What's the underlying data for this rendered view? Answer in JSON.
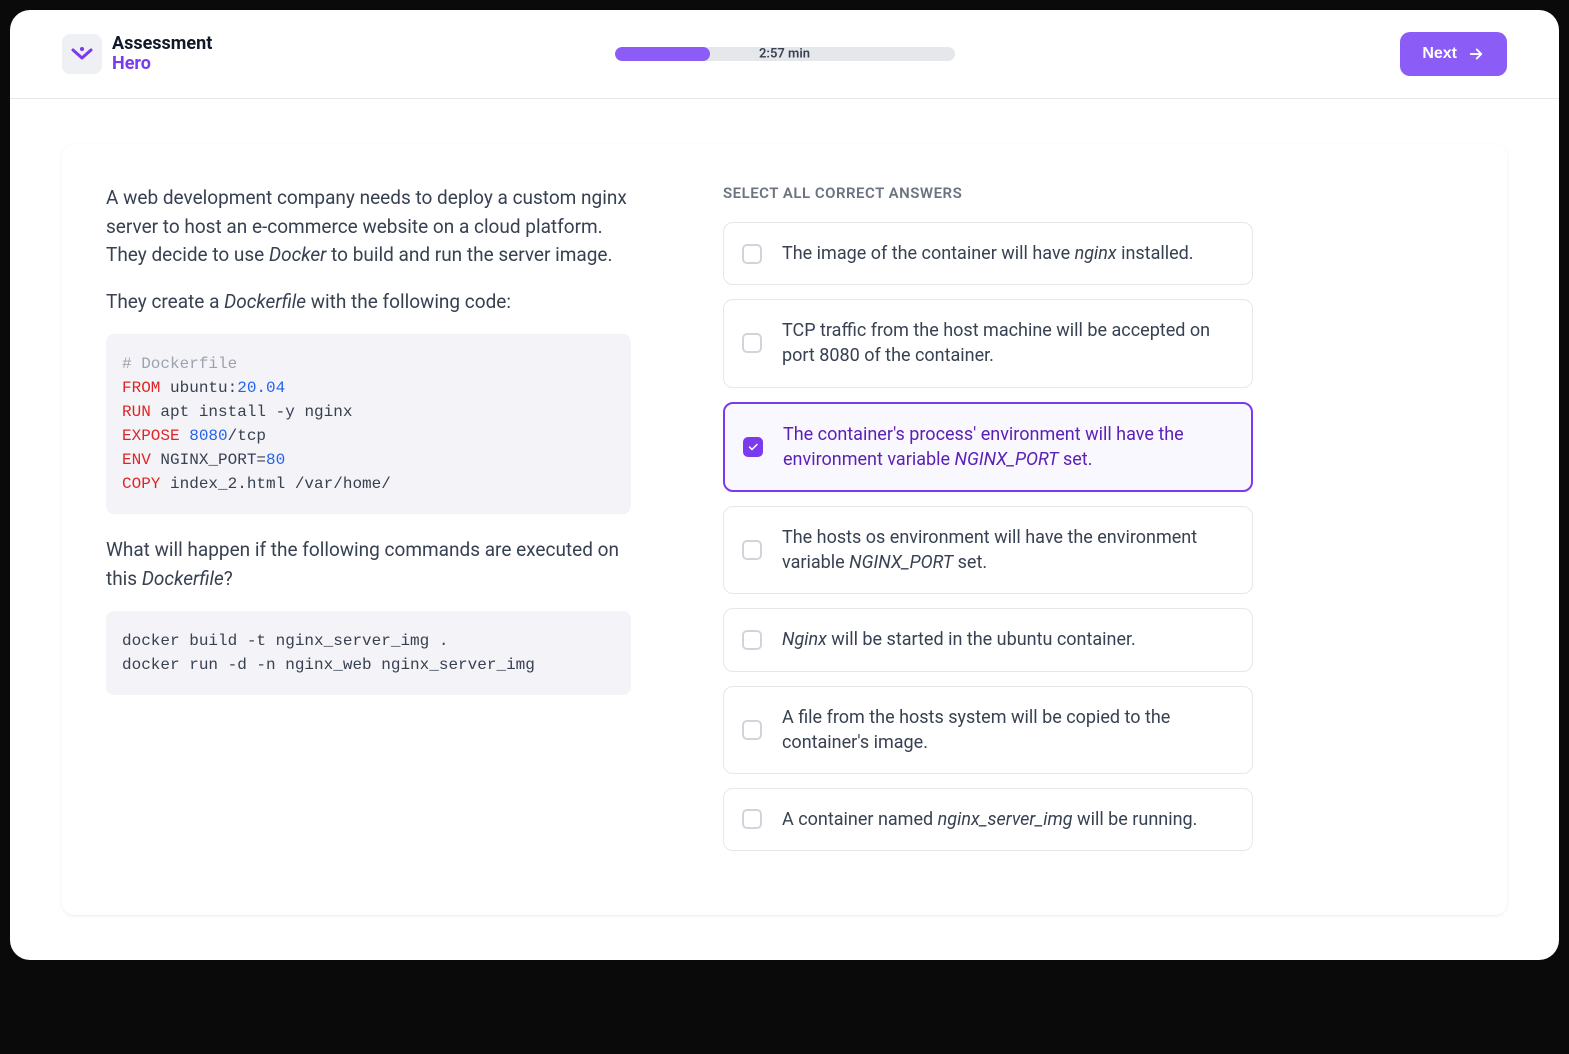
{
  "brand": {
    "line1": "Assessment",
    "line2": "Hero"
  },
  "progress": {
    "label": "2:57 min",
    "percent": 28
  },
  "nextLabel": "Next",
  "question": {
    "para1_pre": "A web development company needs to deploy a custom nginx server to host an e-commerce website on a cloud platform. They decide to use ",
    "para1_em": "Docker",
    "para1_post": " to build and run the server image.",
    "para2_pre": "They create a ",
    "para2_em": "Dockerfile",
    "para2_post": " with the following code:",
    "para3_pre": "What will happen if the following commands are executed on this ",
    "para3_em": "Dockerfile",
    "para3_post": "?"
  },
  "code1": {
    "comment": "# Dockerfile",
    "line2_kw": "FROM",
    "line2_mid": " ubuntu:",
    "line2_num": "20.04",
    "line3_kw": "RUN",
    "line3_rest": " apt install -y nginx",
    "line4_kw": "EXPOSE",
    "line4_sp": " ",
    "line4_num": "8080",
    "line4_rest": "/tcp",
    "line5_kw": "ENV",
    "line5_mid": " NGINX_PORT=",
    "line5_num": "80",
    "line6_kw": "COPY",
    "line6_rest": " index_2.html /var/home/"
  },
  "code2": "docker build -t nginx_server_img .\ndocker run -d -n nginx_web nginx_server_img",
  "answersHeader": "SELECT ALL CORRECT ANSWERS",
  "answers": [
    {
      "pre": "The image of the container will have ",
      "em": "nginx",
      "post": " installed.",
      "selected": false
    },
    {
      "pre": "TCP traffic from the host machine will be accepted on port 8080 of the container.",
      "em": "",
      "post": "",
      "selected": false
    },
    {
      "pre": "The container's process' environment will have the environment variable ",
      "em": "NGINX_PORT",
      "post": " set.",
      "selected": true
    },
    {
      "pre": "The hosts os environment will have the environment variable ",
      "em": "NGINX_PORT",
      "post": " set.",
      "selected": false
    },
    {
      "pre": "",
      "em": "Nginx",
      "post": " will be started in the ubuntu container.",
      "selected": false
    },
    {
      "pre": "A file from the hosts system will be copied to the container's image.",
      "em": "",
      "post": "",
      "selected": false
    },
    {
      "pre": "A container named ",
      "em": "nginx_server_img",
      "post": " will be running.",
      "selected": false
    }
  ]
}
